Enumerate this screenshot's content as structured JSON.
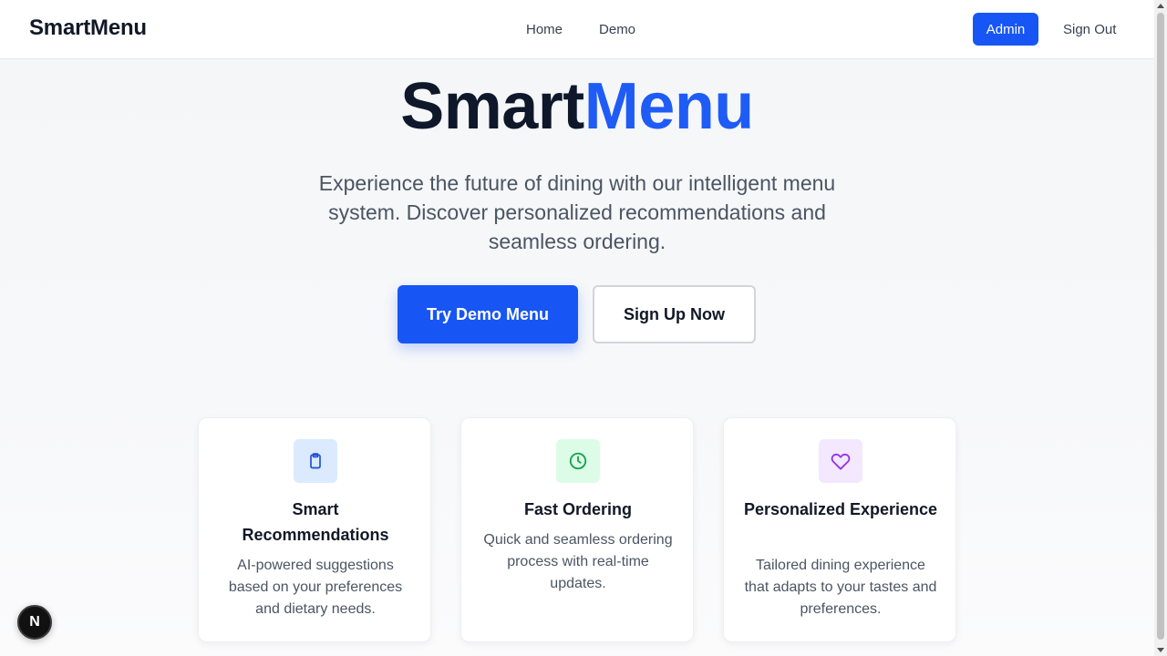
{
  "header": {
    "brand": "SmartMenu",
    "nav": {
      "home": "Home",
      "demo": "Demo"
    },
    "admin_label": "Admin",
    "signout_label": "Sign Out"
  },
  "hero": {
    "title_part1": "Smart",
    "title_part2": "Menu",
    "subtitle": "Experience the future of dining with our intelligent menu system. Discover personalized recommendations and seamless ordering.",
    "primary_cta": "Try Demo Menu",
    "secondary_cta": "Sign Up Now"
  },
  "features": [
    {
      "icon": "clipboard-icon",
      "icon_color": "#1d4ed8",
      "icon_bg": "#dbeafe",
      "title": "Smart Recommendations",
      "description": "AI-powered suggestions based on your preferences and dietary needs."
    },
    {
      "icon": "clock-icon",
      "icon_color": "#16a34a",
      "icon_bg": "#dcfce7",
      "title": "Fast Ordering",
      "description": "Quick and seamless ordering process with real-time updates."
    },
    {
      "icon": "heart-icon",
      "icon_color": "#9333ea",
      "icon_bg": "#f3e8ff",
      "title": "Personalized Experience",
      "description": "Tailored dining experience that adapts to your tastes and preferences."
    }
  ],
  "dev_badge": {
    "label": "N"
  },
  "colors": {
    "accent": "#1756f5",
    "heading": "#0f172a",
    "body_text": "#4b5563"
  }
}
